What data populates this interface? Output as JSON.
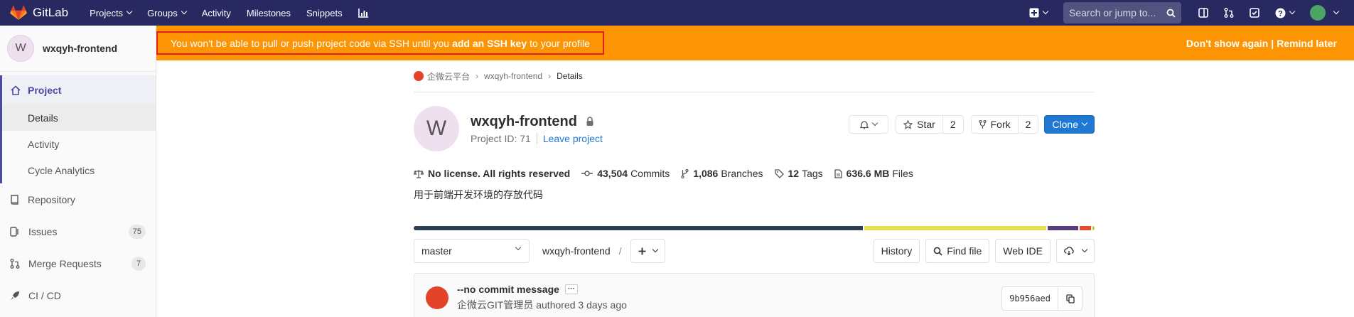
{
  "navbar": {
    "brand": "GitLab",
    "links": [
      "Projects",
      "Groups",
      "Activity",
      "Milestones",
      "Snippets"
    ],
    "search_placeholder": "Search or jump to..."
  },
  "sidebar": {
    "avatar_letter": "W",
    "project_name": "wxqyh-frontend",
    "section": "Project",
    "subitems": [
      "Details",
      "Activity",
      "Cycle Analytics"
    ],
    "items": [
      {
        "label": "Repository",
        "icon": "repository-icon"
      },
      {
        "label": "Issues",
        "icon": "issues-icon",
        "badge": "75"
      },
      {
        "label": "Merge Requests",
        "icon": "merge-request-icon",
        "badge": "7"
      },
      {
        "label": "CI / CD",
        "icon": "rocket-icon"
      }
    ]
  },
  "alert": {
    "pre": "You won't be able to pull or push project code via SSH until you",
    "link": "add an SSH key",
    "post": "to your profile",
    "dismiss": "Don't show again",
    "sep": "|",
    "remind": "Remind later"
  },
  "breadcrumb": {
    "group": "企微云平台",
    "project": "wxqyh-frontend",
    "current": "Details"
  },
  "project": {
    "avatar_letter": "W",
    "name": "wxqyh-frontend",
    "id_text": "Project ID: 71",
    "leave": "Leave project",
    "star_label": "Star",
    "star_count": "2",
    "fork_label": "Fork",
    "fork_count": "2",
    "clone_label": "Clone"
  },
  "stats": {
    "license": "No license. All rights reserved",
    "commits_num": "43,504",
    "commits_label": "Commits",
    "branches_num": "1,086",
    "branches_label": "Branches",
    "tags_num": "12",
    "tags_label": "Tags",
    "files_num": "636.6 MB",
    "files_label": "Files"
  },
  "description": "用于前端开发环境的存放代码",
  "language_bar": [
    {
      "color": "#2c3e50",
      "share": 0.66
    },
    {
      "color": "#e8de52",
      "share": 0.267
    },
    {
      "color": "#563d7c",
      "share": 0.045
    },
    {
      "color": "#e34c26",
      "share": 0.017
    },
    {
      "color": "#a8d042",
      "share": 0.011
    }
  ],
  "toolbar": {
    "branch": "master",
    "path": "wxqyh-frontend",
    "slash": "/",
    "history": "History",
    "find_file": "Find file",
    "web_ide": "Web IDE"
  },
  "commit": {
    "message": "--no commit message",
    "ellipsis": "···",
    "author": "企微云GIT管理员",
    "authored": "authored 3 days ago",
    "sha": "9b956aed"
  }
}
